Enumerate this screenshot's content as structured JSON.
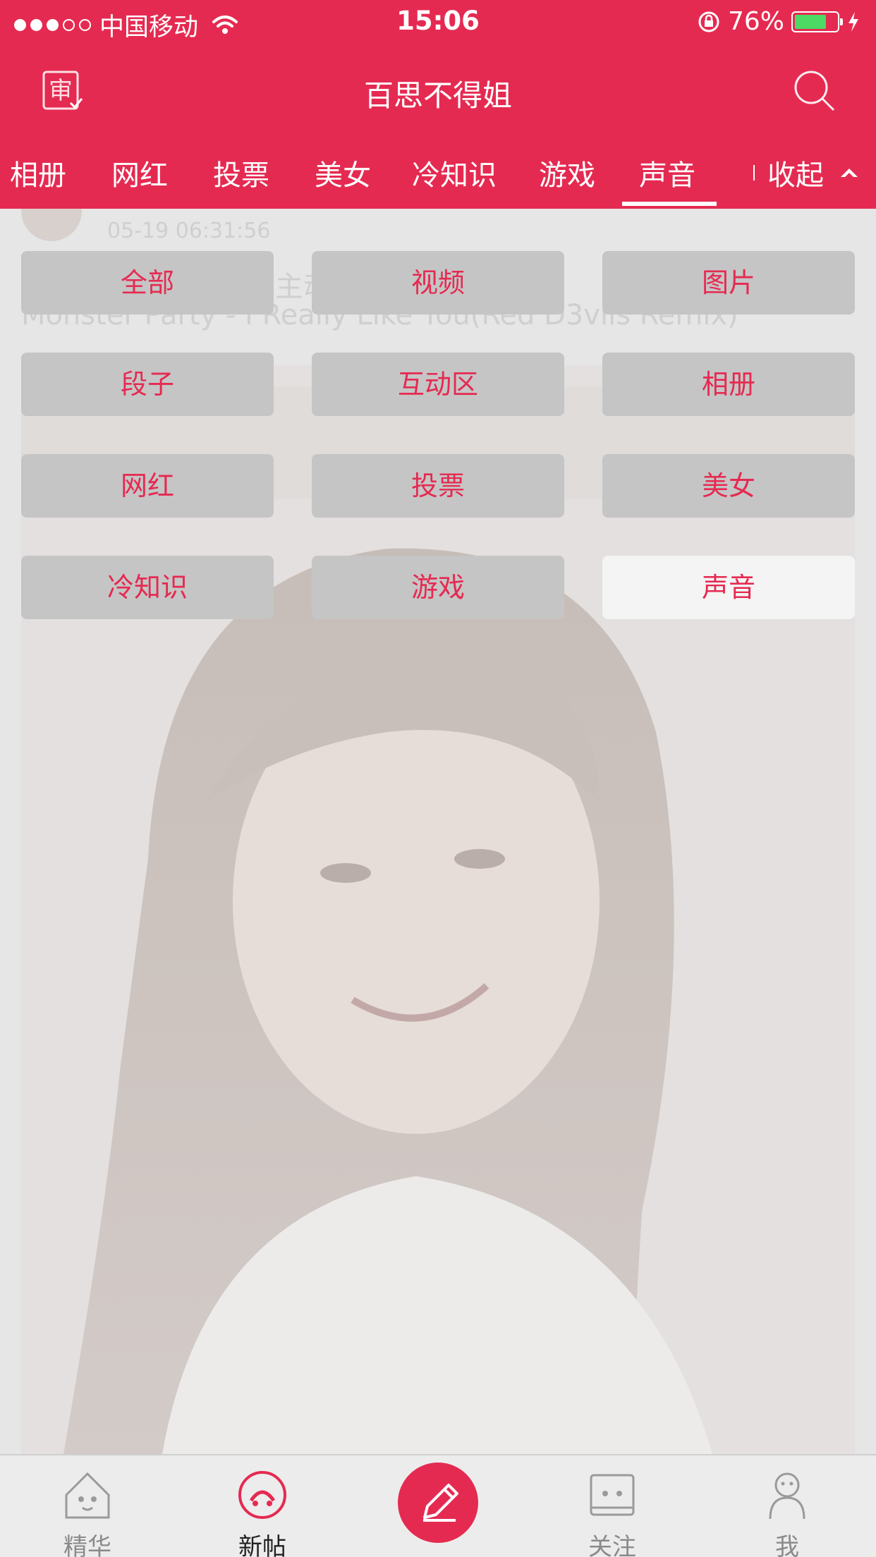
{
  "status": {
    "carrier": "中国移动",
    "time": "15:06",
    "battery": "76%",
    "battery_level": 0.76
  },
  "nav": {
    "title": "百思不得姐"
  },
  "tabs": {
    "items": [
      "相册",
      "网红",
      "投票",
      "美女",
      "冷知识",
      "游戏",
      "声音"
    ],
    "active": "声音",
    "collapse_label": "收起"
  },
  "post": {
    "time": "05-19 06:31:56",
    "text1": "爱情，总有一个人先主动。",
    "text2": "Monster Party - I Really Like You(Red D3vils Remix)"
  },
  "categories": {
    "items": [
      "全部",
      "视频",
      "图片",
      "段子",
      "互动区",
      "相册",
      "网红",
      "投票",
      "美女",
      "冷知识",
      "游戏",
      "声音"
    ],
    "selected": "声音"
  },
  "tabbar": {
    "items": [
      {
        "label": "精华",
        "icon": "home-icon"
      },
      {
        "label": "新帖",
        "icon": "new-post-icon"
      },
      {
        "label": "",
        "icon": "edit-icon"
      },
      {
        "label": "关注",
        "icon": "follow-icon"
      },
      {
        "label": "我",
        "icon": "profile-icon"
      }
    ],
    "active": "新帖"
  },
  "colors": {
    "brand": "#e52a51",
    "battery": "#4cd964",
    "tab_active_text": "#222222",
    "tab_inactive_text": "#8a8a8a"
  }
}
